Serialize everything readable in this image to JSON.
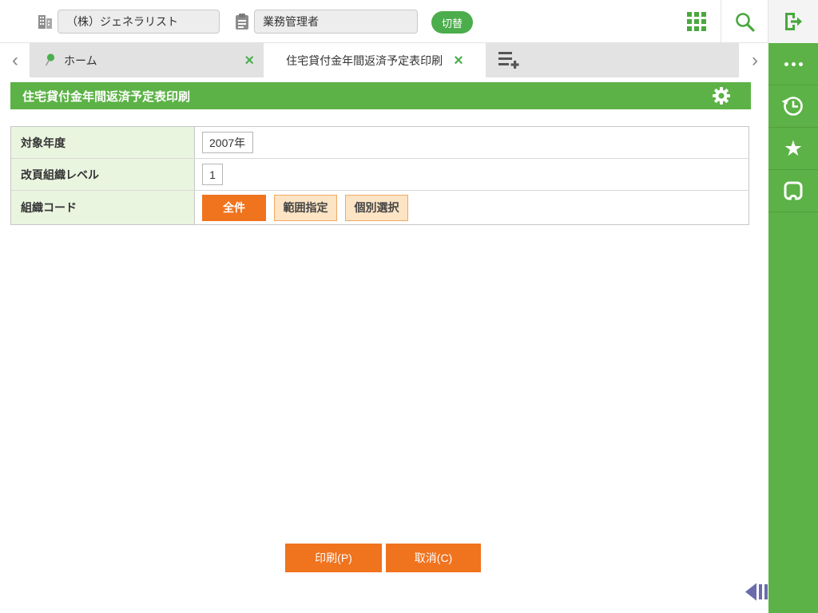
{
  "topbar": {
    "company": {
      "value": "（株）ジェネラリスト"
    },
    "role": {
      "value": "業務管理者"
    },
    "switch_label": "切替"
  },
  "tabbar": {
    "prev_glyph": "‹",
    "next_glyph": "›",
    "home_tab": {
      "label": "ホーム",
      "close_glyph": "×"
    },
    "active_tab": {
      "label": "住宅貸付金年間返済予定表印刷",
      "close_glyph": "×"
    }
  },
  "panel": {
    "title": "住宅貸付金年間返済予定表印刷"
  },
  "form": {
    "target_year": {
      "label": "対象年度",
      "value": "2007年"
    },
    "page_break_level": {
      "label": "改頁組織レベル",
      "value": "1"
    },
    "org_code": {
      "label": "組織コード",
      "options": {
        "all": "全件",
        "range": "範囲指定",
        "individual": "個別選択"
      },
      "selected": "全件"
    }
  },
  "actions": {
    "print": "印刷(P)",
    "cancel": "取消(C)"
  },
  "icons": {
    "topbar": [
      "building-icon",
      "clipboard-icon",
      "app-grid-icon",
      "search-icon",
      "logout-icon"
    ],
    "tabbar": [
      "pin-icon",
      "close-icon",
      "new-tab-icon",
      "chevron-left-icon",
      "chevron-right-icon"
    ],
    "panel": [
      "gear-icon"
    ],
    "sidebar": [
      "ellipsis-icon",
      "history-icon",
      "star-icon",
      "pocket-icon"
    ],
    "footer": [
      "collapse-left-icon"
    ]
  },
  "colors": {
    "brand_green": "#5cb246",
    "icon_green": "#4aa83e",
    "accent_orange": "#f0731e",
    "peach": "#fce4c4",
    "label_green": "#eaf5e0",
    "collapse_arrow": "#6b6bab"
  }
}
